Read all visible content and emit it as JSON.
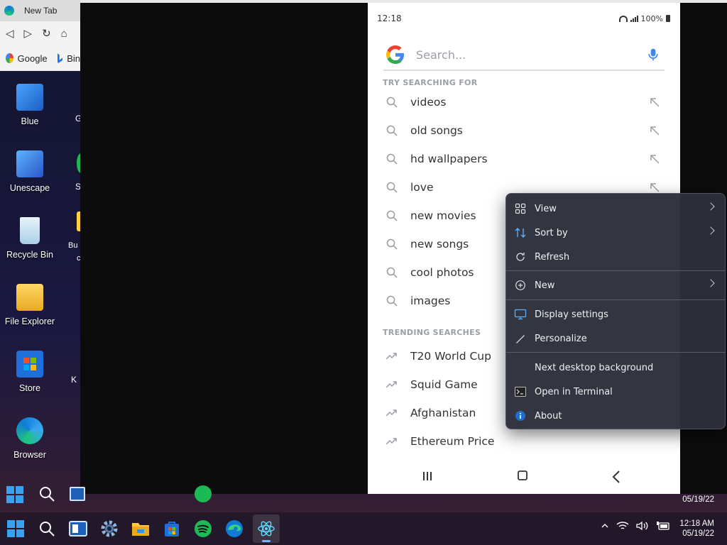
{
  "browser": {
    "tab_title": "New Tab",
    "favorites": [
      {
        "label": "Google"
      },
      {
        "label": "Bin"
      }
    ]
  },
  "desktop": {
    "icons": [
      {
        "label": "Blue",
        "color": "#3a8ee6"
      },
      {
        "label": "Unescape",
        "color": "#2a78d8"
      },
      {
        "label": "Recycle Bin",
        "color": "#cfe6f5"
      },
      {
        "label": "File Explorer",
        "color": "#f5c342"
      },
      {
        "label": "Store",
        "color": "#1e6fd9"
      },
      {
        "label": "Browser",
        "color": "#1fa0e0"
      }
    ],
    "peek_labels": [
      "G",
      "S",
      "Bu",
      "c",
      "K"
    ]
  },
  "phone": {
    "status": {
      "time": "12:18",
      "battery": "100%"
    },
    "search_placeholder": "Search...",
    "try_title": "TRY SEARCHING FOR",
    "suggestions": [
      "videos",
      "old songs",
      "hd wallpapers",
      "love",
      "new movies",
      "new songs",
      "cool photos",
      "images"
    ],
    "trending_title": "TRENDING SEARCHES",
    "trending": [
      "T20 World Cup",
      "Squid Game",
      "Afghanistan",
      "Ethereum Price"
    ]
  },
  "context_menu": {
    "items": [
      {
        "label": "View",
        "icon": "grid-icon",
        "submenu": true
      },
      {
        "label": "Sort by",
        "icon": "sort-icon",
        "submenu": true
      },
      {
        "label": "Refresh",
        "icon": "refresh-icon",
        "submenu": false
      },
      {
        "label": "New",
        "icon": "plus-circle-icon",
        "submenu": true
      },
      {
        "label": "Display settings",
        "icon": "monitor-icon",
        "submenu": false
      },
      {
        "label": "Personalize",
        "icon": "pen-icon",
        "submenu": false
      },
      {
        "label": "Next desktop background",
        "icon": "",
        "submenu": false
      },
      {
        "label": "Open in Terminal",
        "icon": "terminal-icon",
        "submenu": false
      },
      {
        "label": "About",
        "icon": "info-icon",
        "submenu": false
      }
    ]
  },
  "taskbar": {
    "time": "12:18 AM",
    "date": "05/19/22",
    "ghost_date": "05/19/22",
    "accent": "#6fb8ff"
  }
}
